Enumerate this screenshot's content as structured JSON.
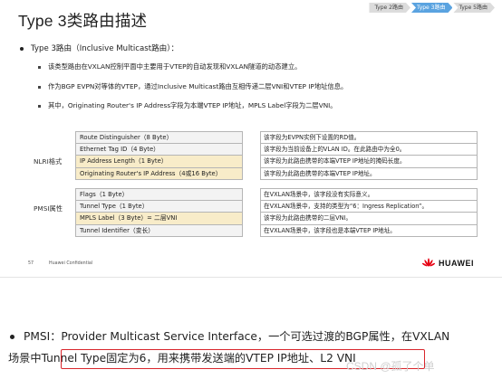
{
  "slide": {
    "title": "Type 3类路由描述",
    "tabs": [
      "Type 2路由",
      "Type 3路由",
      "Type 5路由"
    ],
    "active_tab": 1,
    "bullet": "Type 3路由（Inclusive Multicast路由）：",
    "sub_bullets": [
      "该类型路由在VXLAN控制平面中主要用于VTEP的自动发现和VXLAN隧道的动态建立。",
      "作为BGP EVPN对等体的VTEP，通过Inclusive  Multicast路由互相传递二层VNI和VTEP  IP地址信息。",
      "其中，Originating Router's IP Address字段为本端VTEP IP地址，MPLS Label字段为二层VNI。"
    ],
    "nlri_label": "NLRI格式",
    "pmsi_label": "PMSI属性",
    "nlri_fields": [
      {
        "name": "Route Distinguisher（8 Byte）",
        "highlight": false
      },
      {
        "name": "Ethernet Tag ID（4 Byte）",
        "highlight": false
      },
      {
        "name": "IP Address Length（1 Byte）",
        "highlight": true
      },
      {
        "name": "Originating Router's IP Address（4或16 Byte）",
        "highlight": true
      }
    ],
    "nlri_desc": [
      "该字段为EVPN实例下设置的RD值。",
      "该字段为当前设备上的VLAN ID。在此路由中为全0。",
      "该字段为此路由携带的本端VTEP IP地址的掩码长度。",
      "该字段为此路由携带的本端VTEP IP地址。"
    ],
    "pmsi_fields": [
      {
        "name": "Flags（1 Byte）",
        "highlight": false
      },
      {
        "name": "Tunnel Type（1 Byte）",
        "highlight": false
      },
      {
        "name": "MPLS Label（3 Byte）= 二层VNI",
        "highlight": true
      },
      {
        "name": "Tunnel Identifier（变长）",
        "highlight": false
      }
    ],
    "pmsi_desc": [
      "在VXLAN场景中，该字段没有实际意义。",
      "在VXLAN场景中，支持的类型为“6：Ingress Replication”。",
      "该字段为此路由携带的二层VNI。",
      "在VXLAN场景中，该字段也是本端VTEP IP地址。"
    ],
    "page_number": "57",
    "confidential": "Huawei Confidential",
    "logo_text": "HUAWEI"
  },
  "note": {
    "line1": "PMSI：Provider Multicast Service Interface，一个可选过渡的BGP属性，在VXLAN",
    "line2_prefix": "场景中",
    "line2_boxed": "Tunnel Type固定为6，用来携带发送端的VTEP IP地址、L2 VNI"
  },
  "watermark": "CSDN @孤了个单",
  "colors": {
    "active_tab": "#5aa3e0",
    "highlight_field": "#f8ecc9",
    "red_box": "#d9262c",
    "logo_red": "#e60012"
  }
}
